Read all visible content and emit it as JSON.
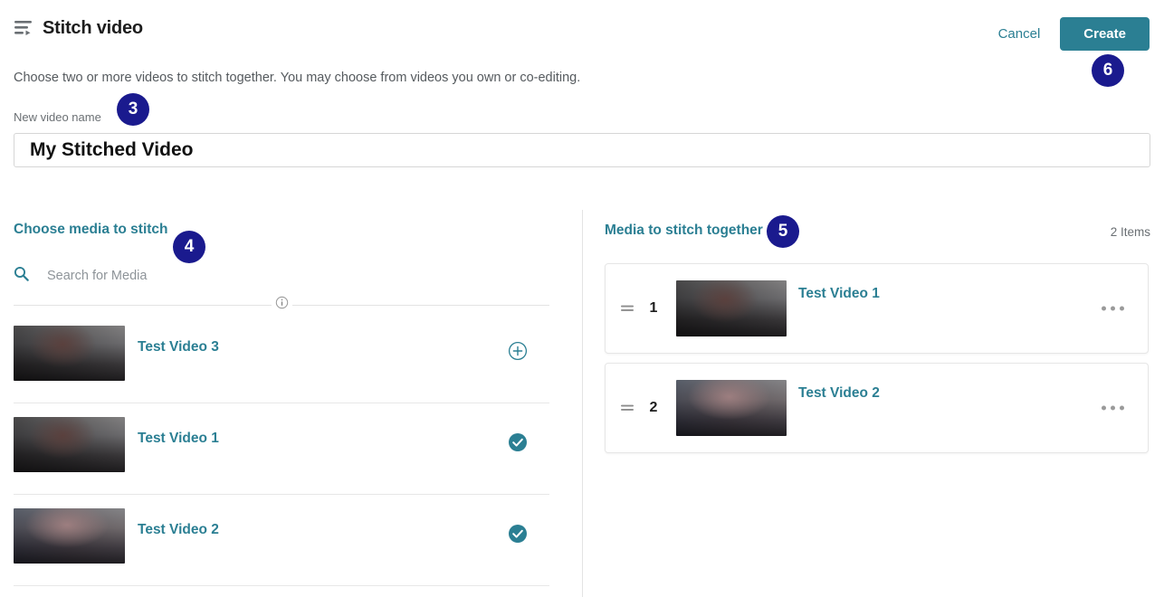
{
  "header": {
    "icon": "stitch-video-icon",
    "title": "Stitch video",
    "cancel_label": "Cancel",
    "create_label": "Create"
  },
  "intro_text": "Choose two or more videos to stitch together. You may choose from videos you own or co-editing.",
  "name_field": {
    "label": "New video name",
    "value": "My Stitched Video",
    "placeholder": "New video name"
  },
  "left_panel": {
    "heading": "Choose media to stitch",
    "search": {
      "icon": "search-icon",
      "placeholder": "Search for Media",
      "value": ""
    },
    "info_icon": "info-icon",
    "items": [
      {
        "title": "Test Video 3",
        "action_icon": "add-circle-icon",
        "selected": false
      },
      {
        "title": "Test Video 1",
        "action_icon": "check-circle-icon",
        "selected": true
      },
      {
        "title": "Test Video 2",
        "action_icon": "check-circle-icon",
        "selected": true
      }
    ]
  },
  "right_panel": {
    "heading": "Media to stitch together",
    "items_count": "2 Items",
    "cards": [
      {
        "order": "1",
        "title": "Test Video 1",
        "handle_icon": "drag-handle-icon",
        "menu_icon": "more-options-icon"
      },
      {
        "order": "2",
        "title": "Test Video 2",
        "handle_icon": "drag-handle-icon",
        "menu_icon": "more-options-icon"
      }
    ]
  },
  "badges": [
    {
      "number": "3"
    },
    {
      "number": "4"
    },
    {
      "number": "5"
    },
    {
      "number": "6"
    }
  ],
  "colors": {
    "accent_teal": "#2b7f93",
    "badge_navy": "#1a1a8e",
    "text_dark": "#1d1d1d",
    "text_muted": "#6a6f73",
    "border": "#e3e3e3"
  }
}
